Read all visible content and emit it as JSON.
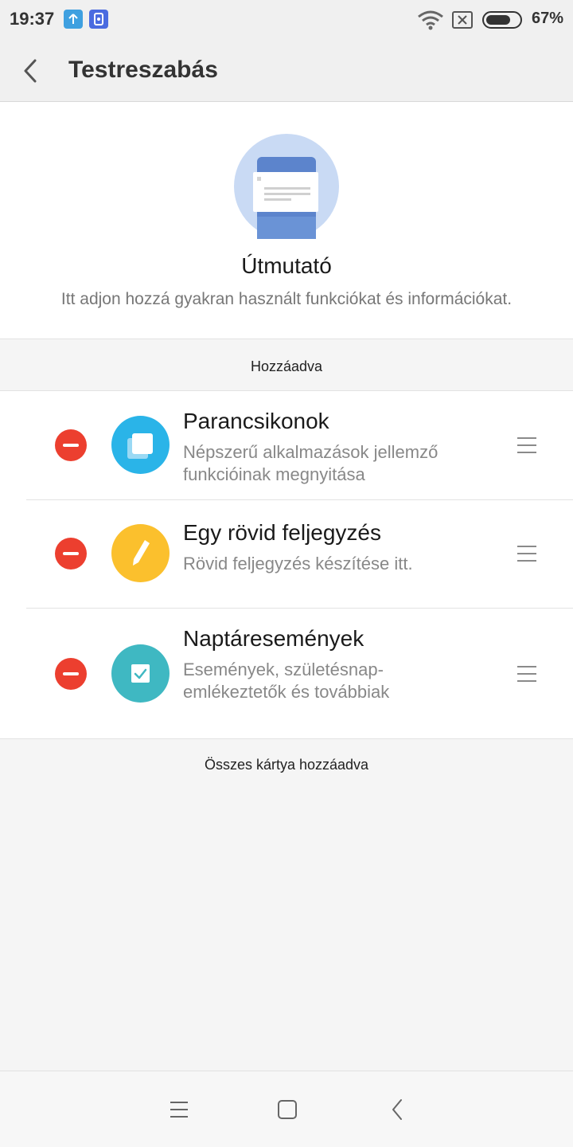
{
  "status_bar": {
    "time": "19:37",
    "battery": "67%",
    "icons": [
      "upload-icon",
      "sim-card-icon",
      "wifi-icon",
      "no-sim-icon",
      "battery-icon"
    ]
  },
  "header": {
    "title": "Testreszabás",
    "back_icon": "chevron-left-icon"
  },
  "intro": {
    "title": "Útmutató",
    "description": "Itt adjon hozzá gyakran használt funkciókat és információkat."
  },
  "sections": {
    "added_label": "Hozzáadva",
    "all_added_label": "Összes kártya hozzáadva"
  },
  "items": [
    {
      "title": "Parancsikonok",
      "description": "Népszerű alkalmazások jellemző funkcióinak megnyitása",
      "icon": "shortcuts-icon",
      "color": "#2ab4e8"
    },
    {
      "title": "Egy rövid feljegyzés",
      "description": "Rövid feljegyzés készítése itt.",
      "icon": "pencil-icon",
      "color": "#fbc02d"
    },
    {
      "title": "Naptáresemények",
      "description": "Események, születésnap-emlékeztetők és továbbiak",
      "icon": "calendar-check-icon",
      "color": "#3fb8c2"
    }
  ],
  "colors": {
    "remove": "#ec3f2f",
    "accent_illustration": "#5c84cc"
  },
  "nav_bar": {
    "icons": [
      "menu-icon",
      "home-icon",
      "back-icon"
    ]
  }
}
